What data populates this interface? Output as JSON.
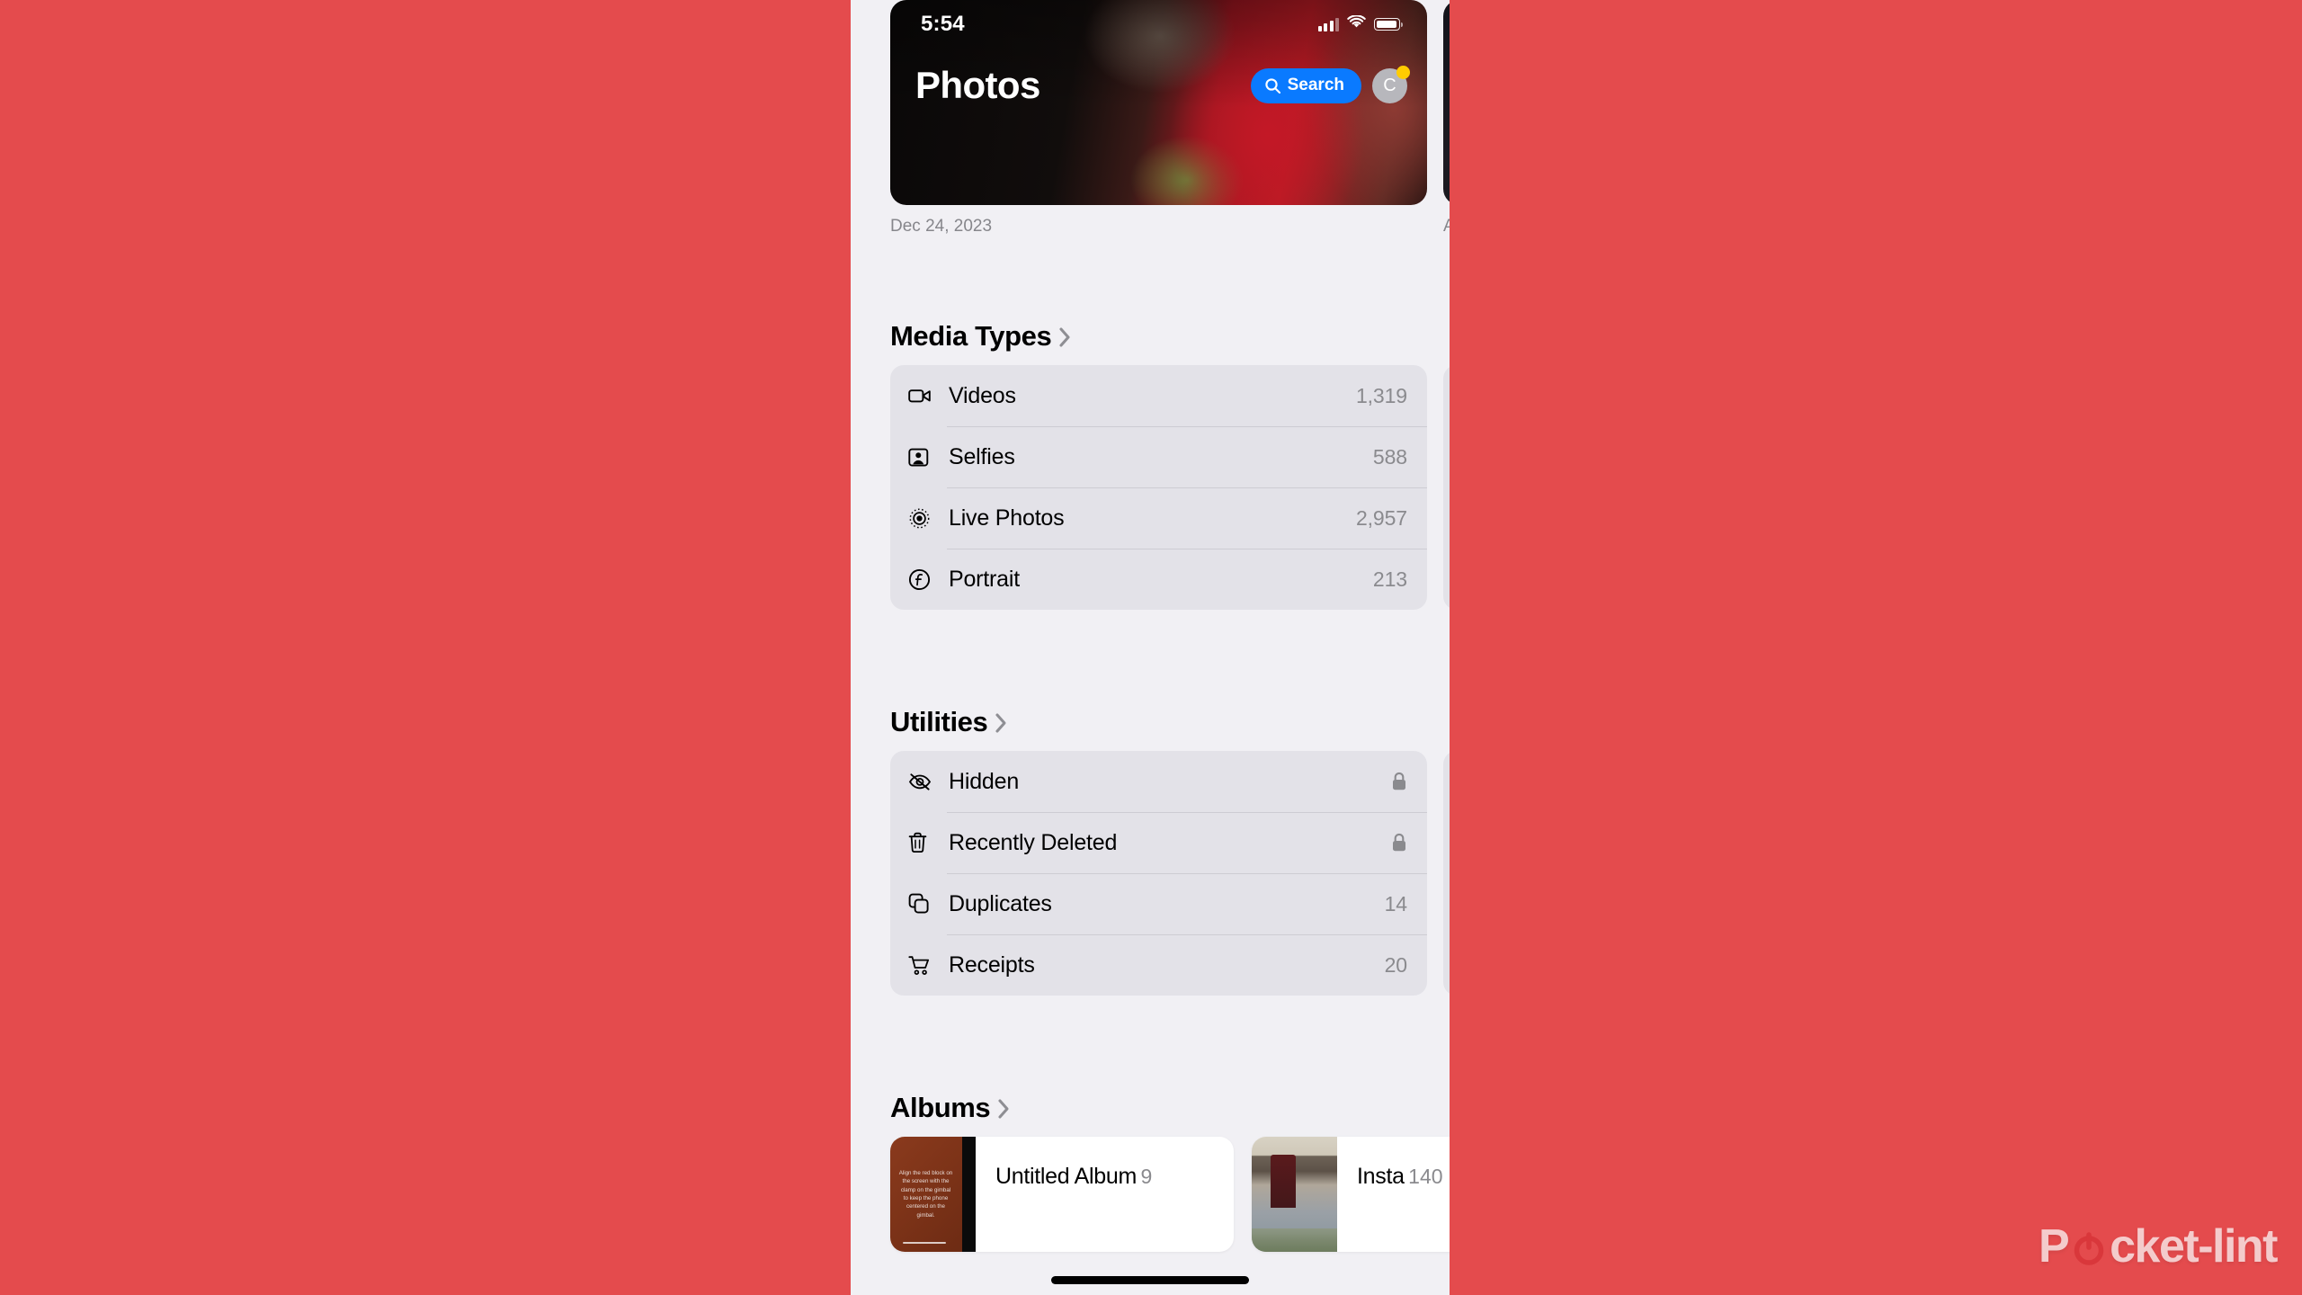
{
  "background_color": "#E44B4D",
  "status_bar": {
    "time": "5:54",
    "cellular_icon": "cellular-signal-icon",
    "wifi_icon": "wifi-icon",
    "battery_icon": "battery-icon"
  },
  "hero": {
    "title": "Photos",
    "search_label": "Search",
    "search_icon": "search-icon",
    "accent_color": "#0A7AFF",
    "avatar_initial": "C",
    "avatar_badge_color": "#FFCC00",
    "captions": [
      "Dec 24, 2023",
      "A"
    ]
  },
  "sections": [
    {
      "id": "media-types",
      "title": "Media Types",
      "chevron_icon": "chevron-right-icon",
      "rows": [
        {
          "icon": "video-camera-icon",
          "label": "Videos",
          "value": "1,319"
        },
        {
          "icon": "selfie-person-icon",
          "label": "Selfies",
          "value": "588"
        },
        {
          "icon": "live-photo-icon",
          "label": "Live Photos",
          "value": "2,957"
        },
        {
          "icon": "portrait-aperture-icon",
          "label": "Portrait",
          "value": "213"
        }
      ]
    },
    {
      "id": "utilities",
      "title": "Utilities",
      "chevron_icon": "chevron-right-icon",
      "rows": [
        {
          "icon": "eye-slash-icon",
          "label": "Hidden",
          "value": "",
          "locked": true,
          "lock_icon": "lock-icon"
        },
        {
          "icon": "trash-icon",
          "label": "Recently Deleted",
          "value": "",
          "locked": true,
          "lock_icon": "lock-icon"
        },
        {
          "icon": "duplicate-squares-icon",
          "label": "Duplicates",
          "value": "14",
          "locked": false
        },
        {
          "icon": "shopping-cart-icon",
          "label": "Receipts",
          "value": "20",
          "locked": false
        }
      ]
    }
  ],
  "albums": {
    "title": "Albums",
    "chevron_icon": "chevron-right-icon",
    "items": [
      {
        "name": "Untitled Album",
        "count": "9",
        "thumb_caption": "Align the red block on the screen with the clamp on the gimbal to keep the phone centered on the gimbal."
      },
      {
        "name": "Insta",
        "count": "140",
        "thumb_caption": ""
      }
    ]
  },
  "watermark": {
    "text_before": "P",
    "text_after": "cket-lint",
    "power_icon": "power-button-icon"
  }
}
